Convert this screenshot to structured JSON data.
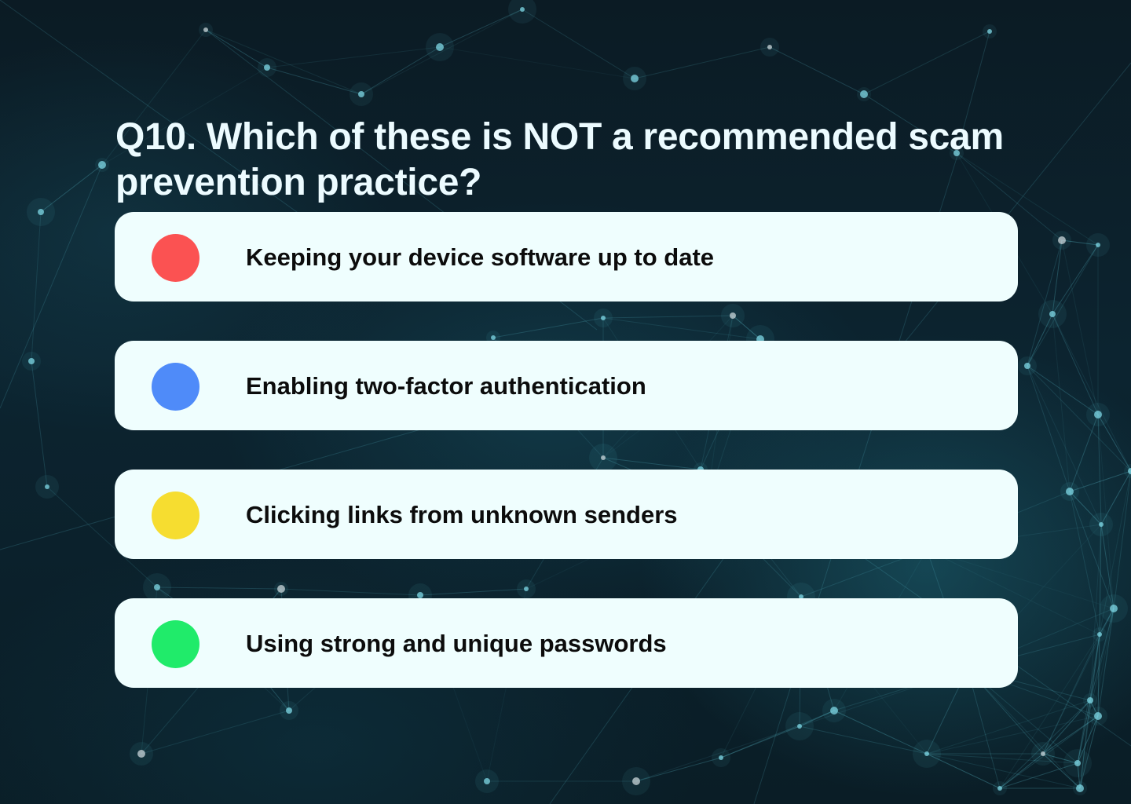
{
  "question": {
    "text": "Q10. Which of these is NOT a recommended scam prevention practice?"
  },
  "options": [
    {
      "label": "Keeping your device software up to date",
      "marker_color": "#fb5252"
    },
    {
      "label": "Enabling two-factor authentication",
      "marker_color": "#4f8bf9"
    },
    {
      "label": "Clicking links from unknown senders",
      "marker_color": "#f6dd30"
    },
    {
      "label": "Using strong and unique passwords",
      "marker_color": "#20eb6a"
    }
  ],
  "background": {
    "theme": "network-plexus",
    "base_color": "#0b1e27",
    "line_color": "#5fc6d6"
  }
}
